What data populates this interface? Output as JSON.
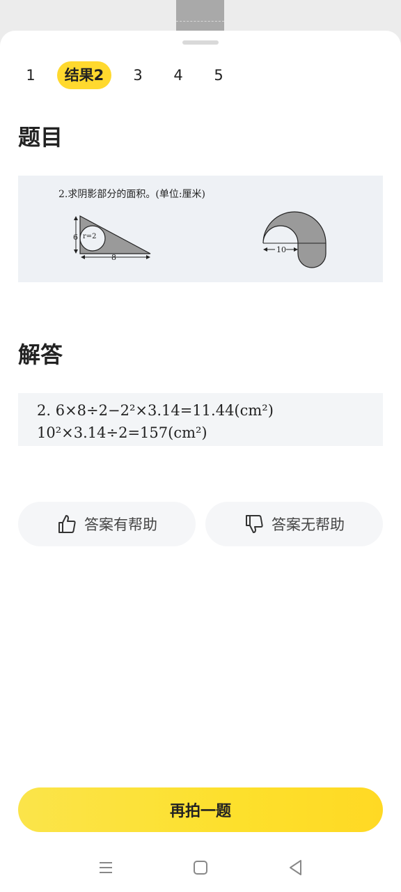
{
  "tabs": [
    {
      "label": "1",
      "active": false
    },
    {
      "label": "结果2",
      "active": true
    },
    {
      "label": "3",
      "active": false
    },
    {
      "label": "4",
      "active": false
    },
    {
      "label": "5",
      "active": false
    }
  ],
  "question": {
    "title": "题目",
    "image_text": "2.求阴影部分的面积。(单位:厘米)",
    "fig1_label_height": "6",
    "fig1_label_r": "r=2",
    "fig1_label_base": "8",
    "fig2_label_width": "10"
  },
  "answer": {
    "title": "解答",
    "line1": "2. 6×8÷2−2²×3.14=11.44(cm²)",
    "line2": "10²×3.14÷2=157(cm²)"
  },
  "feedback": {
    "helpful_label": "答案有帮助",
    "unhelpful_label": "答案无帮助"
  },
  "cta_label": "再拍一题",
  "nav": {
    "menu_icon": "menu-icon",
    "home_icon": "home-icon",
    "back_icon": "back-icon"
  }
}
